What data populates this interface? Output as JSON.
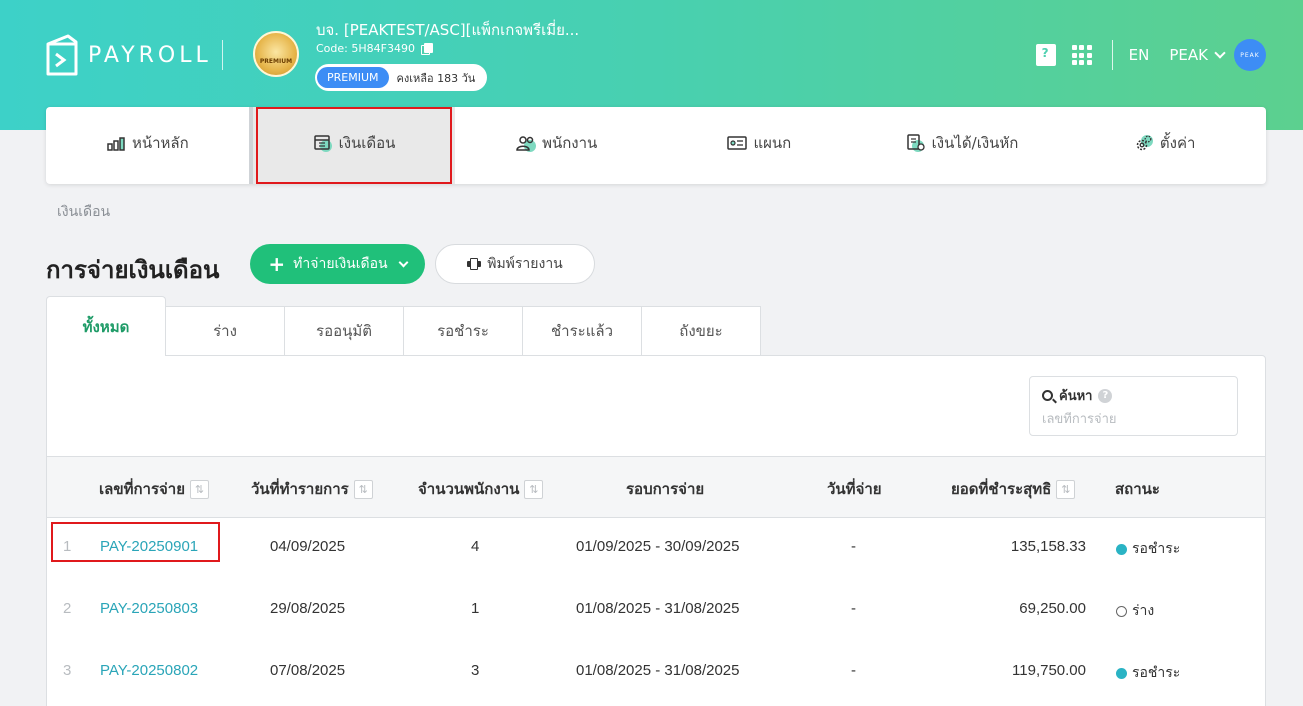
{
  "header": {
    "app_name": "PAYROLL",
    "company_name": "บจ. [PEAKTEST/ASC][แพ็กเกจพรีเมี่ย...",
    "company_code": "Code: 5H84F3490",
    "company_logo_text": "PREMIUM",
    "plan_badge": "PREMIUM",
    "plan_remaining": "คงเหลือ 183 วัน",
    "language": "EN",
    "user_name": "PEAK",
    "avatar_text": "PEAK"
  },
  "nav": {
    "items": [
      {
        "label": "หน้าหลัก",
        "icon": "bar-chart-icon"
      },
      {
        "label": "เงินเดือน",
        "icon": "calendar-icon"
      },
      {
        "label": "พนักงาน",
        "icon": "users-icon"
      },
      {
        "label": "แผนก",
        "icon": "id-card-icon"
      },
      {
        "label": "เงินได้/เงินหัก",
        "icon": "money-icon"
      },
      {
        "label": "ตั้งค่า",
        "icon": "gear-icon"
      }
    ],
    "active_index": 1
  },
  "breadcrumb": "เงินเดือน",
  "page_title": "การจ่ายเงินเดือน",
  "toolbar": {
    "run_payroll_label": "ทำจ่ายเงินเดือน",
    "print_report_label": "พิมพ์รายงาน"
  },
  "tabs": [
    "ทั้งหมด",
    "ร่าง",
    "รออนุมัติ",
    "รอชำระ",
    "ชำระแล้ว",
    "ถังขยะ"
  ],
  "active_tab": 0,
  "search": {
    "label": "ค้นหา",
    "placeholder": "เลขที่การจ่าย"
  },
  "table": {
    "columns": [
      "เลขที่การจ่าย",
      "วันที่ทำรายการ",
      "จำนวนพนักงาน",
      "รอบการจ่าย",
      "วันที่จ่าย",
      "ยอดที่ชำระสุทธิ",
      "สถานะ"
    ],
    "rows": [
      {
        "num": "1",
        "pay_no": "PAY-20250901",
        "date": "04/09/2025",
        "employees": "4",
        "period": "01/09/2025 - 30/09/2025",
        "paid_date": "-",
        "net": "135,158.33",
        "status": "รอชำระ",
        "status_style": "filled"
      },
      {
        "num": "2",
        "pay_no": "PAY-20250803",
        "date": "29/08/2025",
        "employees": "1",
        "period": "01/08/2025 - 31/08/2025",
        "paid_date": "-",
        "net": "69,250.00",
        "status": "ร่าง",
        "status_style": "hollow"
      },
      {
        "num": "3",
        "pay_no": "PAY-20250802",
        "date": "07/08/2025",
        "employees": "3",
        "period": "01/08/2025 - 31/08/2025",
        "paid_date": "-",
        "net": "119,750.00",
        "status": "รอชำระ",
        "status_style": "filled"
      }
    ]
  },
  "colors": {
    "brand_green": "#20c07a",
    "link": "#2aa5b8",
    "highlight": "#e0191c",
    "status_waiting": "#2ab3c4"
  }
}
